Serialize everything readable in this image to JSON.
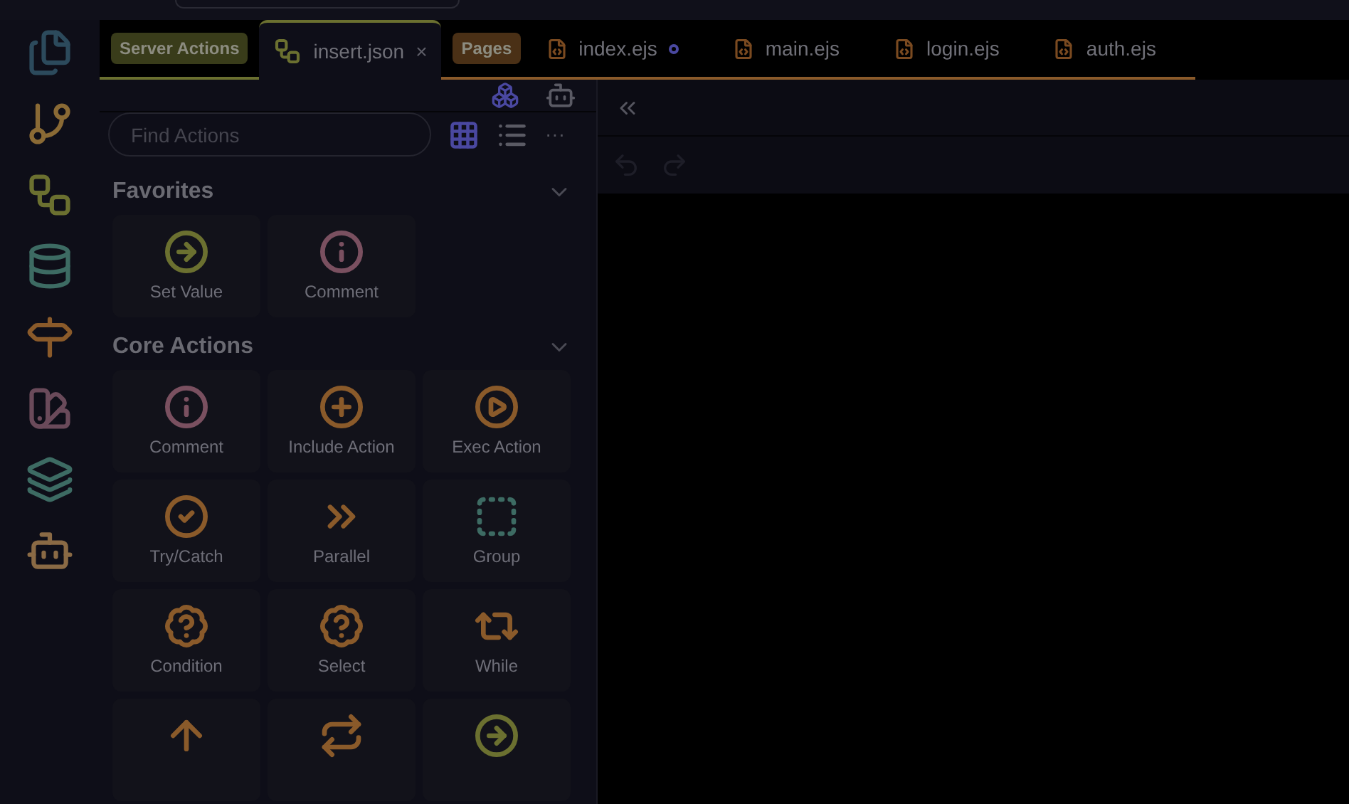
{
  "tab_groups": [
    {
      "badge": "Server Actions",
      "color": "#6b7030",
      "tabs": [
        {
          "label": "insert.json",
          "selected": true,
          "modified": false,
          "close": "×",
          "kind": "flow"
        }
      ]
    },
    {
      "badge": "Pages",
      "color": "#8a5a2a",
      "tabs": [
        {
          "label": "index.ejs",
          "selected": false,
          "modified": true,
          "kind": "html"
        },
        {
          "label": "main.ejs",
          "selected": false,
          "modified": false,
          "kind": "html"
        },
        {
          "label": "login.ejs",
          "selected": false,
          "modified": false,
          "kind": "html"
        },
        {
          "label": "auth.ejs",
          "selected": false,
          "modified": false,
          "kind": "html"
        }
      ]
    }
  ],
  "search": {
    "placeholder": "Find Actions"
  },
  "views": [
    {
      "kind": "grid",
      "selected": true
    },
    {
      "kind": "list",
      "selected": false
    }
  ],
  "more": "···",
  "sections": [
    {
      "title": "Favorites",
      "expanded": true,
      "actions": [
        {
          "label": "Set Value",
          "kind": "setvalue"
        },
        {
          "label": "Comment",
          "kind": "comment"
        }
      ]
    },
    {
      "title": "Core Actions",
      "expanded": true,
      "actions": [
        {
          "label": "Comment",
          "kind": "comment"
        },
        {
          "label": "Include Action",
          "kind": "include"
        },
        {
          "label": "Exec Action",
          "kind": "exec"
        },
        {
          "label": "Try/Catch",
          "kind": "trycatch"
        },
        {
          "label": "Parallel",
          "kind": "parallel"
        },
        {
          "label": "Group",
          "kind": "group"
        },
        {
          "label": "Condition",
          "kind": "condition"
        },
        {
          "label": "Select",
          "kind": "condition"
        },
        {
          "label": "While",
          "kind": "while"
        },
        {
          "kind": "up"
        },
        {
          "kind": "repeat"
        },
        {
          "kind": "setvalue"
        }
      ]
    }
  ]
}
